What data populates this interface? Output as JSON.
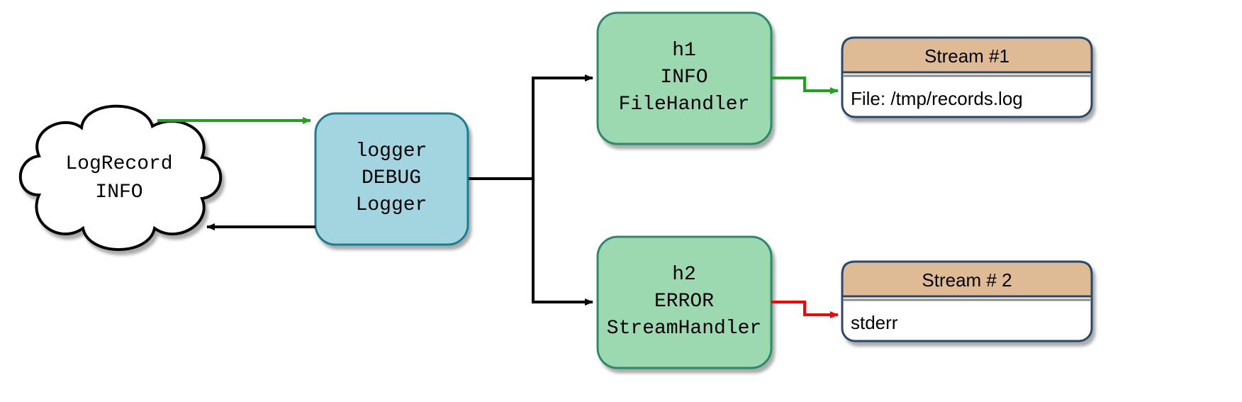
{
  "colors": {
    "cloud_fill": "#ffffff",
    "cloud_stroke": "#000000",
    "shadow": "#b7b7b7",
    "logger_fill": "#a3d5e1",
    "logger_stroke": "#1b7d91",
    "handler_fill": "#9cd8b0",
    "handler_stroke": "#2a8a6b",
    "stream_title_fill": "#debb94",
    "stream_body_fill": "#ffffff",
    "stream_stroke": "#2a4a6a",
    "arrow_green": "#1fa31f",
    "arrow_red": "#ff0000",
    "arrow_black": "#000000"
  },
  "logrecord": {
    "line1": "LogRecord",
    "line2": "INFO"
  },
  "logger": {
    "line1": "logger",
    "line2": "DEBUG",
    "line3": "Logger"
  },
  "handlers": [
    {
      "name_line1": "h1",
      "name_line2": "INFO",
      "name_line3": "FileHandler"
    },
    {
      "name_line1": "h2",
      "name_line2": "ERROR",
      "name_line3": "StreamHandler"
    }
  ],
  "streams": [
    {
      "title": "Stream #1",
      "body": "File: /tmp/records.log"
    },
    {
      "title": "Stream # 2",
      "body": "stderr"
    }
  ]
}
